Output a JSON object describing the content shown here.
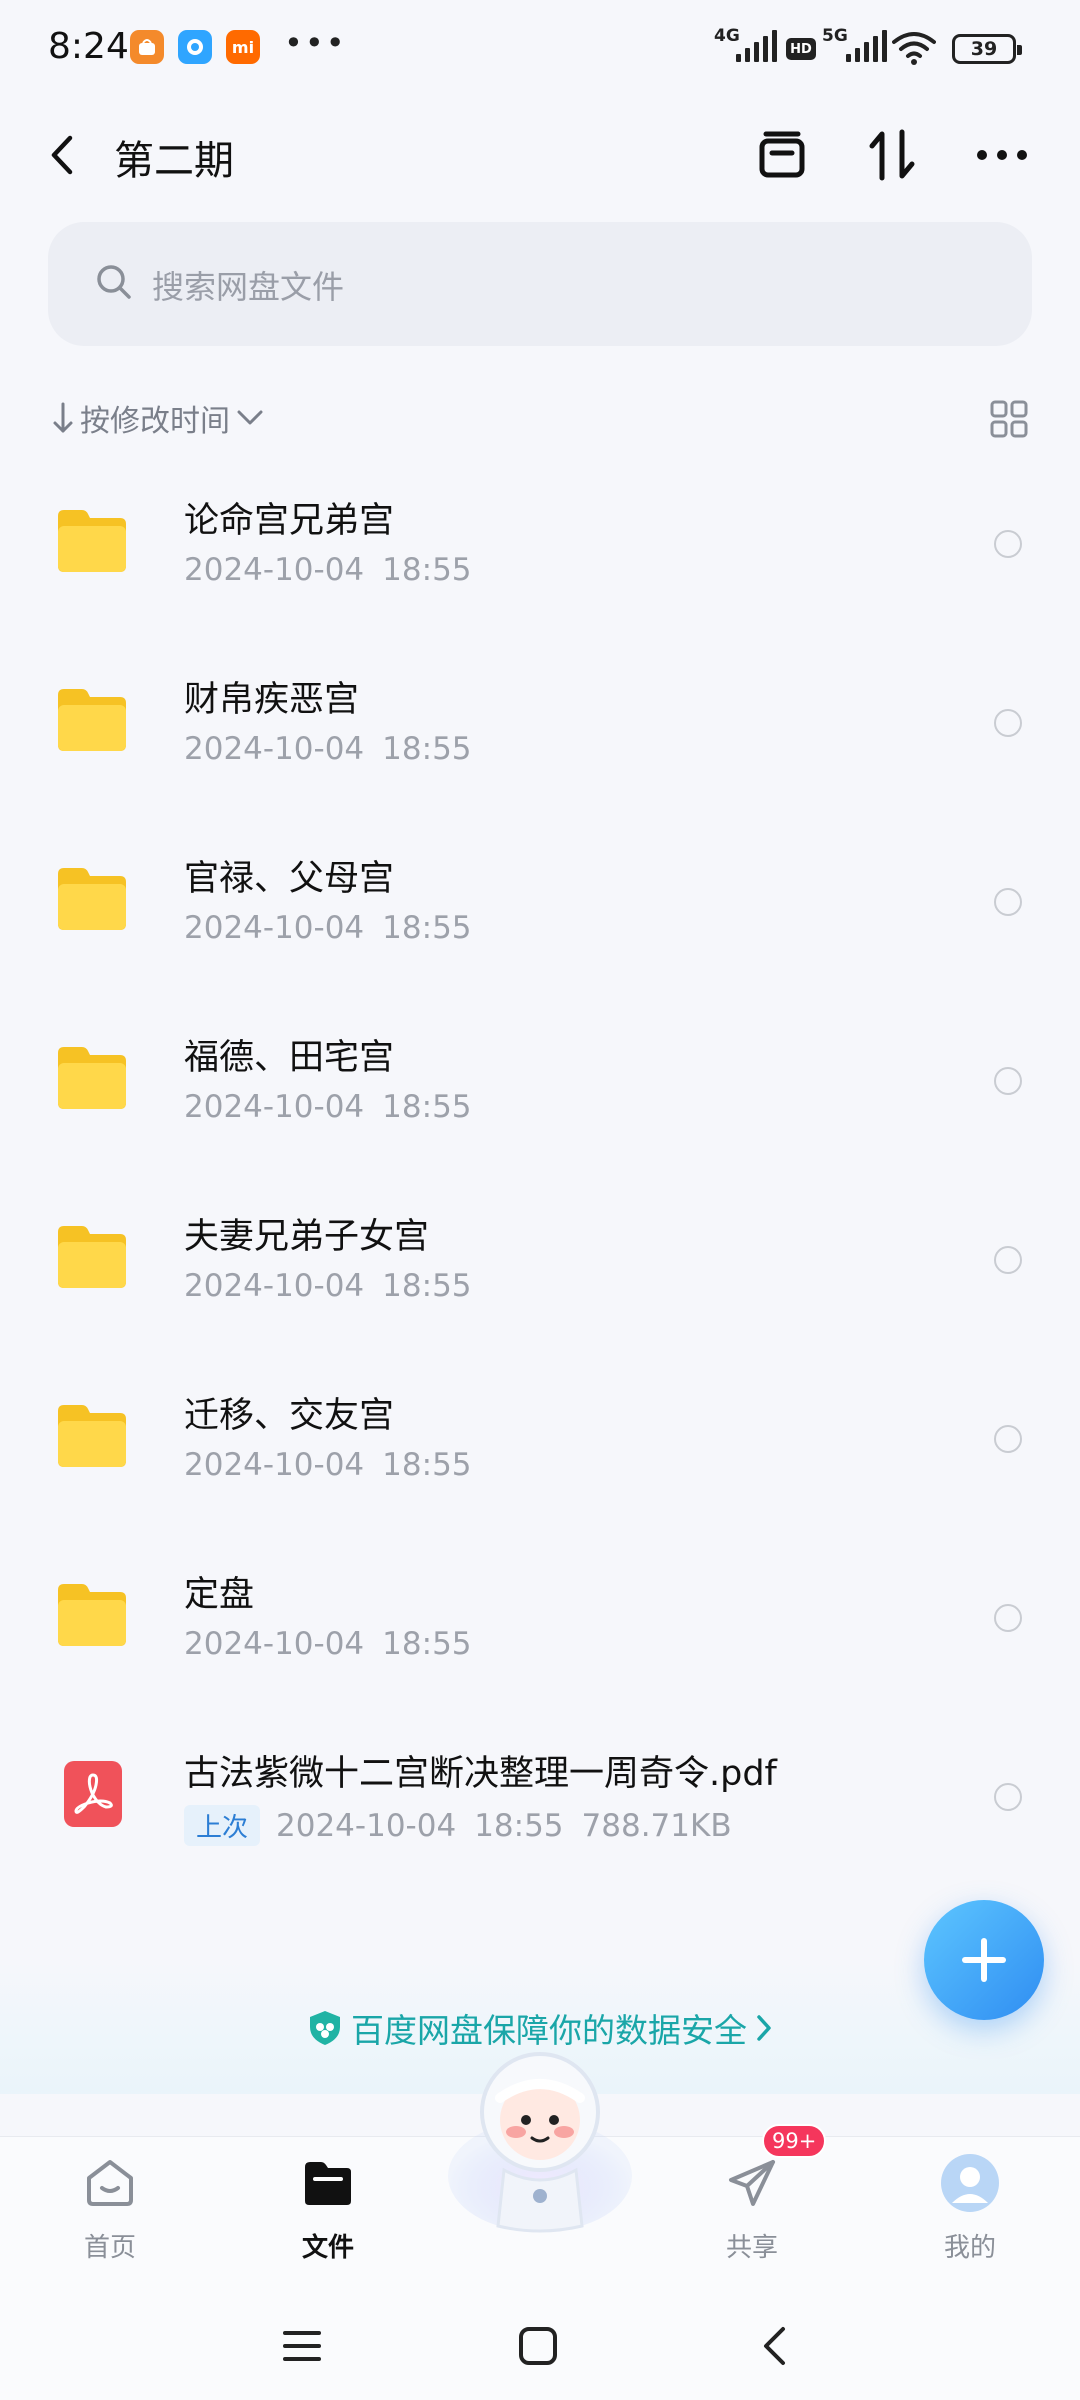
{
  "status_bar": {
    "time": "8:24",
    "app_icons": [
      {
        "name": "taobao-icon",
        "color": "#f48a2b"
      },
      {
        "name": "messenger-icon",
        "color": "#2fa5ff"
      },
      {
        "name": "mi-icon",
        "color": "#ff6a00",
        "text": "mi"
      }
    ],
    "more": "•••",
    "sim1_label": "4G",
    "hd_label": "HD",
    "sim2_label": "5G",
    "battery": "39"
  },
  "header": {
    "title": "第二期"
  },
  "search": {
    "placeholder": "搜索网盘文件"
  },
  "sort": {
    "label": "按修改时间"
  },
  "files": [
    {
      "name": "论命宫兄弟宫",
      "date": "2024-10-04",
      "time": "18:55",
      "type": "folder"
    },
    {
      "name": "财帛疾恶宫",
      "date": "2024-10-04",
      "time": "18:55",
      "type": "folder"
    },
    {
      "name": "官禄、父母宫",
      "date": "2024-10-04",
      "time": "18:55",
      "type": "folder"
    },
    {
      "name": "福德、田宅宫",
      "date": "2024-10-04",
      "time": "18:55",
      "type": "folder"
    },
    {
      "name": "夫妻兄弟子女宫",
      "date": "2024-10-04",
      "time": "18:55",
      "type": "folder"
    },
    {
      "name": "迁移、交友宫",
      "date": "2024-10-04",
      "time": "18:55",
      "type": "folder"
    },
    {
      "name": "定盘",
      "date": "2024-10-04",
      "time": "18:55",
      "type": "folder"
    },
    {
      "name": "古法紫微十二宫断决整理一周奇令.pdf",
      "date": "2024-10-04",
      "time": "18:55",
      "type": "pdf",
      "badge": "上次",
      "size": "788.71KB"
    }
  ],
  "security_banner": {
    "text": "百度网盘保障你的数据安全",
    "color": "#1aa6a8"
  },
  "bottom_nav": {
    "items": [
      {
        "label": "首页"
      },
      {
        "label": "文件"
      },
      {
        "label": "共享"
      },
      {
        "label": "我的"
      }
    ],
    "share_badge": "99+"
  },
  "colors": {
    "accent": "#2f8df2",
    "folder": "#ffd43b",
    "pdf": "#f0525a",
    "badge": "#f5365c"
  }
}
